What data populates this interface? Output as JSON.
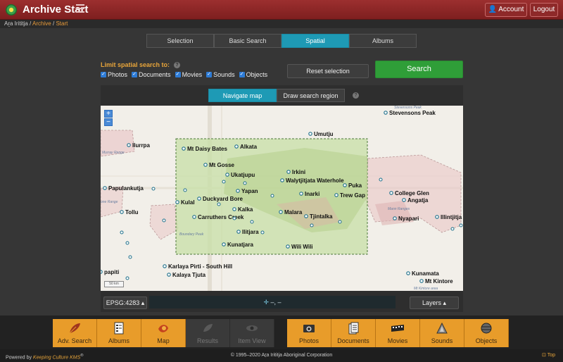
{
  "app": {
    "title": "Archive Start",
    "account_label": "Account",
    "logout_label": "Logout"
  },
  "breadcrumb": {
    "root": "Aṟa Irititja",
    "sep1": "/",
    "archive": "Archive",
    "sep2": "/",
    "start": "Start"
  },
  "tabs": [
    {
      "label": "Selection",
      "active": false
    },
    {
      "label": "Basic Search",
      "active": false
    },
    {
      "label": "Spatial",
      "active": true
    },
    {
      "label": "Albums",
      "active": false
    }
  ],
  "limit": {
    "label": "Limit spatial search to:",
    "options": [
      {
        "label": "Photos",
        "checked": true
      },
      {
        "label": "Documents",
        "checked": true
      },
      {
        "label": "Movies",
        "checked": true
      },
      {
        "label": "Sounds",
        "checked": true
      },
      {
        "label": "Objects",
        "checked": true
      }
    ]
  },
  "actions": {
    "reset_label": "Reset selection",
    "search_label": "Search"
  },
  "map_tabs": [
    {
      "label": "Navigate map",
      "active": true
    },
    {
      "label": "Draw search region",
      "active": false
    }
  ],
  "map": {
    "zoom_in": "+",
    "zoom_out": "−",
    "scale_label": "50 km",
    "places": [
      "Stevensons Peak",
      "Umutju",
      "Ilurrpa",
      "Mt Daisy Bates",
      "Alkata",
      "Mt Gosse",
      "Ukatjupu",
      "Irkini",
      "Walytjitjata Waterhole",
      "Puka",
      "Papulankutja",
      "Yapan",
      "Inarki",
      "Trew Gap",
      "College Glen",
      "Angatja",
      "Kulal",
      "Duckyard Bore",
      "Tollu",
      "Kalka",
      "Malara",
      "Tjintalka",
      "Nyapari",
      "Illintjitja",
      "Carruthers Creek",
      "Ilitjara",
      "Kunatjara",
      "Wili Wili",
      "Karlaya Pirti - South Hill",
      "papiti",
      "Kalaya Tjuta",
      "Kunamata",
      "Mt Kintore"
    ],
    "features": [
      "Stevensons Peak",
      "Murray Range",
      "Mann Ranges",
      "Boundary Peak",
      "Mt Kintore area",
      "one Range"
    ]
  },
  "map_footer": {
    "epsg_label": "EPSG:4283",
    "coords": "–, –",
    "layers_label": "Layers"
  },
  "nav_left": [
    {
      "label": "Adv. Search",
      "icon": "leaf-icon",
      "enabled": true
    },
    {
      "label": "Albums",
      "icon": "albums-icon",
      "enabled": true
    },
    {
      "label": "Map",
      "icon": "map-icon",
      "enabled": true
    },
    {
      "label": "Results",
      "icon": "results-icon",
      "enabled": false
    },
    {
      "label": "Item View",
      "icon": "eye-icon",
      "enabled": false
    }
  ],
  "nav_right": [
    {
      "label": "Photos",
      "icon": "camera-icon"
    },
    {
      "label": "Documents",
      "icon": "documents-icon"
    },
    {
      "label": "Movies",
      "icon": "film-icon"
    },
    {
      "label": "Sounds",
      "icon": "sound-icon"
    },
    {
      "label": "Objects",
      "icon": "objects-icon"
    }
  ],
  "footer": {
    "powered_prefix": "Powered by",
    "powered_brand": "Keeping Culture KMS",
    "reg": "®",
    "copyright": "© 1995–2020 Aṟa Irititja Aboriginal Corporation",
    "top_label": "Top"
  },
  "colors": {
    "brand_red": "#8e2929",
    "accent_teal": "#1e9ab5",
    "search_green": "#2f9e38",
    "nav_orange": "#e89c2a"
  }
}
